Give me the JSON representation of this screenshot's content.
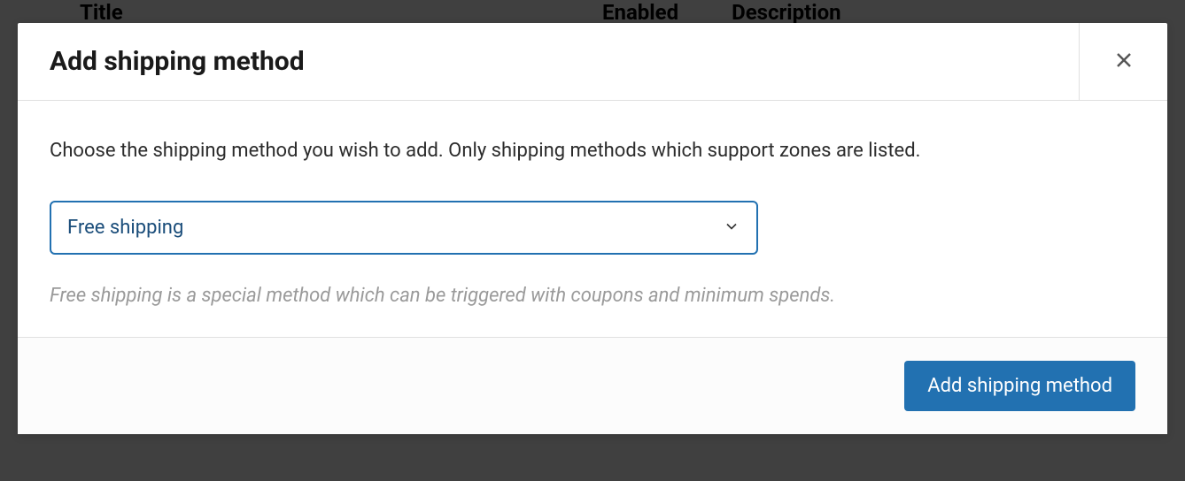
{
  "background": {
    "headers": {
      "title": "Title",
      "enabled": "Enabled",
      "description": "Description"
    }
  },
  "modal": {
    "title": "Add shipping method",
    "instruction": "Choose the shipping method you wish to add. Only shipping methods which support zones are listed.",
    "select": {
      "value": "Free shipping",
      "options": [
        "Free shipping"
      ]
    },
    "method_description": "Free shipping is a special method which can be triggered with coupons and minimum spends.",
    "footer": {
      "add_button_label": "Add shipping method"
    }
  }
}
